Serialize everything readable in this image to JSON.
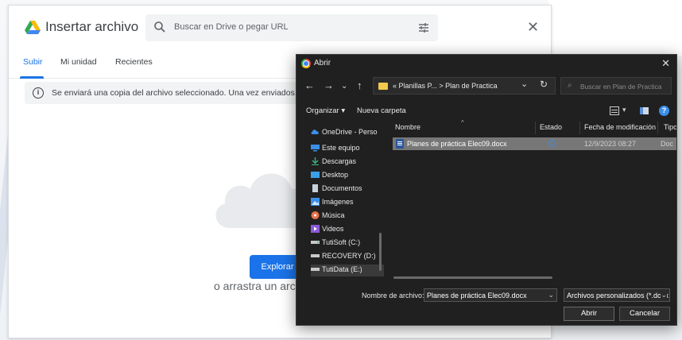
{
  "picker": {
    "title": "Insertar archivo",
    "search_placeholder": "Buscar en Drive o pegar URL",
    "tabs": [
      {
        "label": "Subir",
        "active": true
      },
      {
        "label": "Mi unidad",
        "active": false
      },
      {
        "label": "Recientes",
        "active": false
      }
    ],
    "info_message": "Se enviará una copia del archivo seleccionado. Una vez enviados, los",
    "explore_button": "Explorar",
    "drag_text": "o arrastra un arc",
    "close_glyph": "✕"
  },
  "dialog": {
    "title": "Abrir",
    "close_glyph": "✕",
    "breadcrumb": "«  Planillas P...  >  Plan de Practica",
    "search_placeholder": "Buscar en Plan de Practica",
    "toolbar": {
      "organize": "Organizar ▾",
      "new_folder": "Nueva carpeta"
    },
    "nav_items": [
      {
        "label": "OneDrive - Perso",
        "icon": "cloud-icon",
        "color": "#3a8fe8"
      },
      {
        "label": "Este equipo",
        "icon": "computer-icon",
        "color": "#3a8fe8"
      },
      {
        "label": "Descargas",
        "icon": "download-icon",
        "color": "#3fb27f"
      },
      {
        "label": "Desktop",
        "icon": "desktop-icon",
        "color": "#3aa0e8"
      },
      {
        "label": "Documentos",
        "icon": "document-icon",
        "color": "#c8d0dc"
      },
      {
        "label": "Imágenes",
        "icon": "image-icon",
        "color": "#3a8fe8"
      },
      {
        "label": "Música",
        "icon": "music-icon",
        "color": "#e8734a"
      },
      {
        "label": "Videos",
        "icon": "video-icon",
        "color": "#8a5ad6"
      },
      {
        "label": "TutiSoft (C:)",
        "icon": "drive-icon",
        "color": "#c8c8c8"
      },
      {
        "label": "RECOVERY (D:)",
        "icon": "drive-icon",
        "color": "#c8c8c8"
      },
      {
        "label": "TutiData (E:)",
        "icon": "drive-icon",
        "color": "#c8c8c8",
        "selected": true
      }
    ],
    "columns": [
      "Nombre",
      "Estado",
      "Fecha de modificación",
      "Tipo"
    ],
    "files": [
      {
        "name": "Planes de práctica Elec09.docx",
        "date": "12/9/2023 08:27",
        "type": "Doc"
      }
    ],
    "filename_label": "Nombre de archivo:",
    "filename_value": "Planes de práctica Elec09.docx",
    "filetype_value": "Archivos personalizados (*.docx",
    "open_button": "Abrir",
    "cancel_button": "Cancelar"
  },
  "colors": {
    "accent": "#1a73e8",
    "dialog_bg": "#202020",
    "selected_row": "#777777"
  }
}
